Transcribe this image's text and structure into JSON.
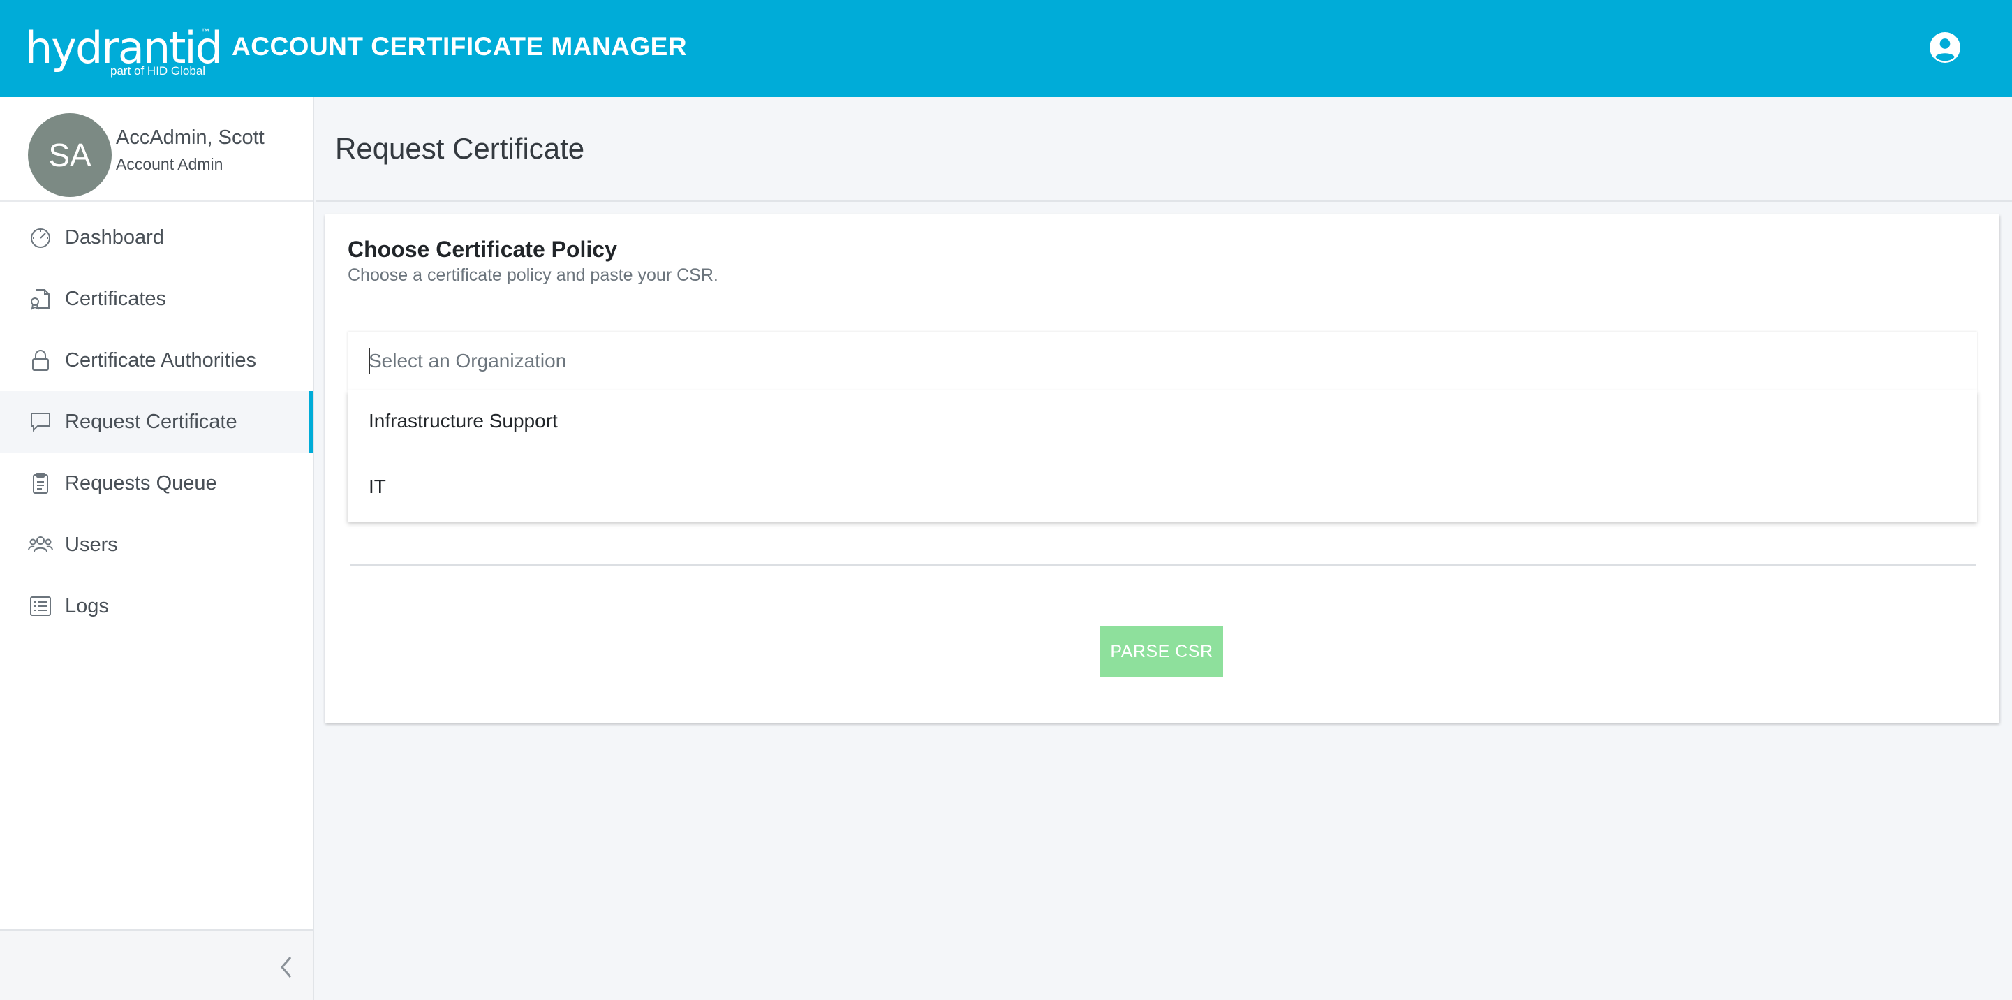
{
  "header": {
    "logo_text": "hydrantid",
    "logo_tm": "™",
    "logo_subtext": "part of HID Global",
    "app_title": "ACCOUNT CERTIFICATE MANAGER",
    "account_icon": "account-circle-icon"
  },
  "user": {
    "initials": "SA",
    "name": "AccAdmin, Scott",
    "role": "Account Admin"
  },
  "sidebar": {
    "items": [
      {
        "label": "Dashboard",
        "icon": "gauge-icon"
      },
      {
        "label": "Certificates",
        "icon": "certificate-icon"
      },
      {
        "label": "Certificate Authorities",
        "icon": "lock-icon"
      },
      {
        "label": "Request Certificate",
        "icon": "message-icon",
        "active": true
      },
      {
        "label": "Requests Queue",
        "icon": "clipboard-icon"
      },
      {
        "label": "Users",
        "icon": "users-icon"
      },
      {
        "label": "Logs",
        "icon": "list-icon"
      }
    ],
    "collapse_icon": "chevron-left-icon"
  },
  "page": {
    "title": "Request Certificate"
  },
  "card": {
    "title": "Choose Certificate Policy",
    "subtitle": "Choose a certificate policy and paste your CSR.",
    "organization_select": {
      "placeholder": "Select an Organization",
      "value": "",
      "options": [
        "Infrastructure Support",
        "IT"
      ]
    },
    "parse_button_label": "PARSE CSR"
  },
  "colors": {
    "header": "#00acd8",
    "accent": "#00acd8",
    "avatar": "#7c8a84",
    "parse_button": "#8ee09c"
  }
}
